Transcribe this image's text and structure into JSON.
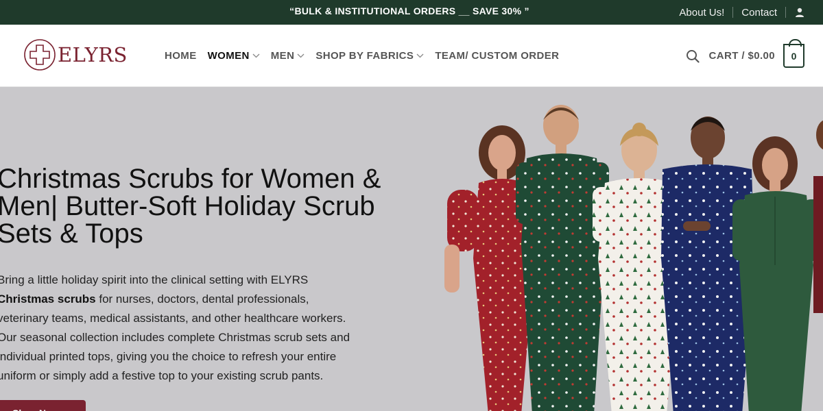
{
  "topbar": {
    "promo": "“BULK & INSTITUTIONAL ORDERS __ SAVE 30% ”",
    "about": "About Us!",
    "contact": "Contact",
    "user_icon": "user-icon"
  },
  "header": {
    "brand": "ELYRS",
    "logo_icon": "cross-in-circle-icon",
    "nav": [
      {
        "label": "HOME"
      },
      {
        "label": "WOMEN"
      },
      {
        "label": "MEN"
      },
      {
        "label": "SHOP BY FABRICS"
      },
      {
        "label": "TEAM/ CUSTOM ORDER"
      }
    ],
    "cart_label": "CART / $0.00",
    "cart_count": "0",
    "search_icon": "search-icon"
  },
  "hero": {
    "title_line1": "Christmas Scrubs for Women &",
    "title_line2": "Men| Butter-Soft Holiday Scrub",
    "title_line3": "Sets & Tops",
    "body_line1": "Bring a little holiday spirit into the clinical setting with ELYRS",
    "body_bold": "Christmas scrubs",
    "body_line2_rest": " for nurses, doctors, dental professionals,",
    "body_line3": "veterinary teams, medical assistants, and other healthcare workers.",
    "body_line4": "Our seasonal collection includes complete Christmas scrub sets and",
    "body_line5": "individual printed tops, giving you the choice to refresh your entire",
    "body_line6": "uniform or simply add a festive top to your existing scrub pants.",
    "cta": "Shop Now"
  },
  "colors": {
    "topbar_bg": "#1f3a2b",
    "brand": "#7a2230",
    "hero_bg": "#c9c8cb"
  }
}
